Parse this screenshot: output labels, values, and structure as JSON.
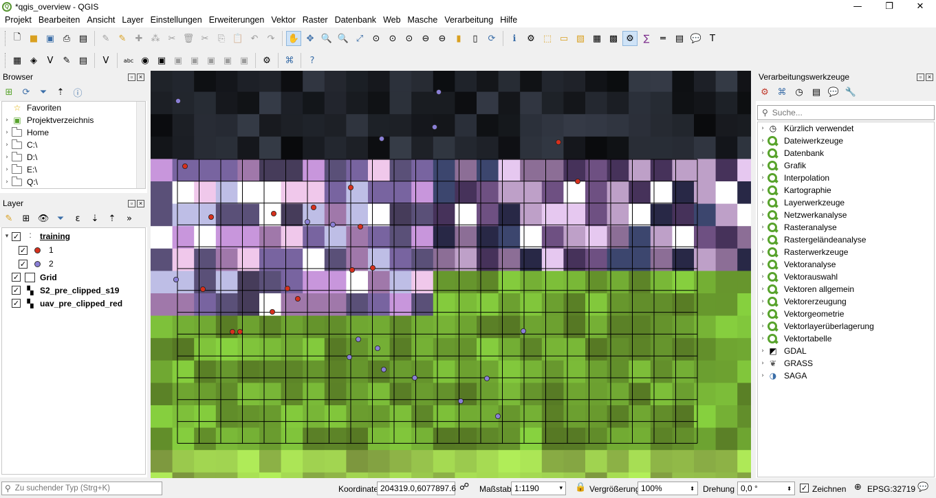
{
  "window": {
    "title": "*qgis_overview - QGIS",
    "min_icon": "—",
    "max_icon": "❐",
    "close_icon": "✕"
  },
  "menu": [
    "Projekt",
    "Bearbeiten",
    "Ansicht",
    "Layer",
    "Einstellungen",
    "Erweiterungen",
    "Vektor",
    "Raster",
    "Datenbank",
    "Web",
    "Masche",
    "Verarbeitung",
    "Hilfe"
  ],
  "browser": {
    "title": "Browser",
    "items": [
      {
        "label": "Favoriten",
        "icon": "star-icon"
      },
      {
        "label": "Projektverzeichnis",
        "icon": "project-folder-icon"
      },
      {
        "label": "Home",
        "icon": "folder-icon"
      },
      {
        "label": "C:\\",
        "icon": "folder-icon"
      },
      {
        "label": "D:\\",
        "icon": "folder-icon"
      },
      {
        "label": "E:\\",
        "icon": "folder-icon"
      },
      {
        "label": "Q:\\",
        "icon": "folder-icon"
      }
    ]
  },
  "layers": {
    "title": "Layer",
    "group": {
      "label": "training"
    },
    "classes": [
      {
        "label": "1",
        "color": "#d6301d"
      },
      {
        "label": "2",
        "color": "#8a7fd6"
      }
    ],
    "others": [
      {
        "label": "Grid",
        "icon": "polygon-layer-icon"
      },
      {
        "label": "S2_pre_clipped_s19",
        "icon": "raster-layer-icon"
      },
      {
        "label": "uav_pre_clipped_red",
        "icon": "raster-layer-icon"
      }
    ]
  },
  "processing": {
    "title": "Verarbeitungswerkzeuge",
    "search_placeholder": "Suche...",
    "items": [
      {
        "label": "Kürzlich verwendet",
        "icon": "clock-icon"
      },
      {
        "label": "Dateiwerkzeuge",
        "icon": "qgis-icon"
      },
      {
        "label": "Datenbank",
        "icon": "qgis-icon"
      },
      {
        "label": "Grafik",
        "icon": "qgis-icon"
      },
      {
        "label": "Interpolation",
        "icon": "qgis-icon"
      },
      {
        "label": "Kartographie",
        "icon": "qgis-icon"
      },
      {
        "label": "Layerwerkzeuge",
        "icon": "qgis-icon"
      },
      {
        "label": "Netzwerkanalyse",
        "icon": "qgis-icon"
      },
      {
        "label": "Rasteranalyse",
        "icon": "qgis-icon"
      },
      {
        "label": "Rastergeländeanalyse",
        "icon": "qgis-icon"
      },
      {
        "label": "Rasterwerkzeuge",
        "icon": "qgis-icon"
      },
      {
        "label": "Vektoranalyse",
        "icon": "qgis-icon"
      },
      {
        "label": "Vektorauswahl",
        "icon": "qgis-icon"
      },
      {
        "label": "Vektoren allgemein",
        "icon": "qgis-icon"
      },
      {
        "label": "Vektorerzeugung",
        "icon": "qgis-icon"
      },
      {
        "label": "Vektorgeometrie",
        "icon": "qgis-icon"
      },
      {
        "label": "Vektorlayerüberlagerung",
        "icon": "qgis-icon"
      },
      {
        "label": "Vektortabelle",
        "icon": "qgis-icon"
      },
      {
        "label": "GDAL",
        "icon": "gdal-icon"
      },
      {
        "label": "GRASS",
        "icon": "grass-icon"
      },
      {
        "label": "SAGA",
        "icon": "saga-icon"
      }
    ]
  },
  "status": {
    "locator_placeholder": "Zu suchender Typ (Strg+K)",
    "coord_label": "Koordinate",
    "coord_value": "204319.0,6077897.6",
    "scale_label": "Maßstab",
    "scale_value": "1:1190",
    "magnify_label": "Vergrößerung",
    "magnify_value": "100%",
    "rotation_label": "Drehung",
    "rotation_value": "0,0 °",
    "render_label": "Zeichnen",
    "crs": "EPSG:32719"
  }
}
